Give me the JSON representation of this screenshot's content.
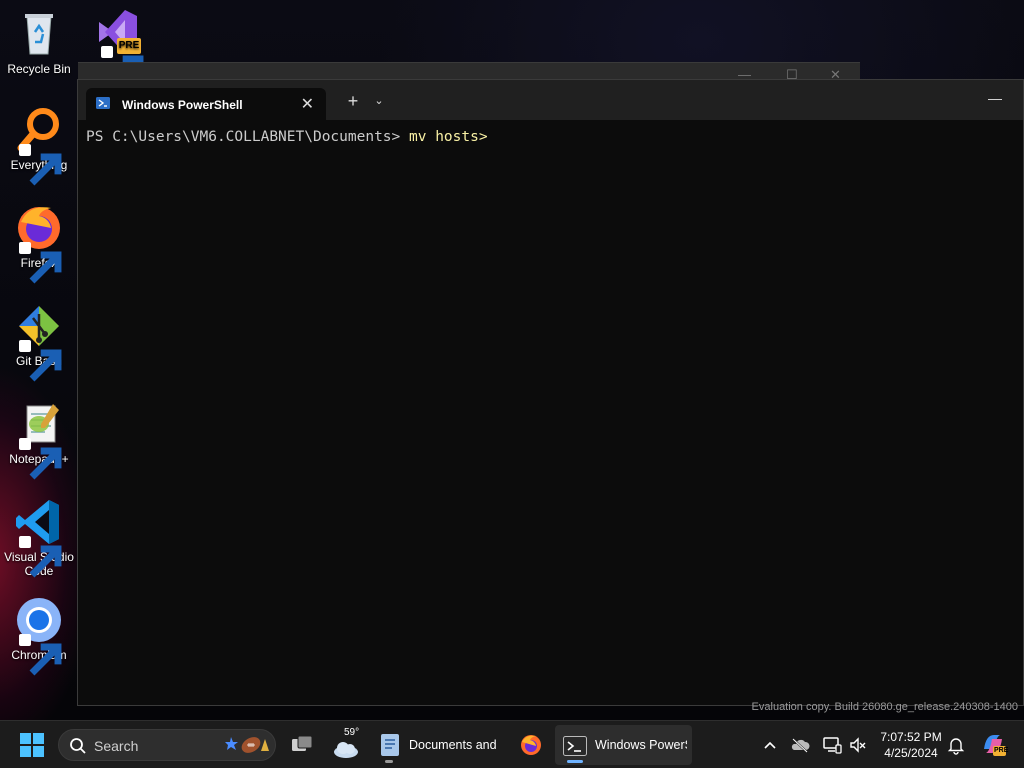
{
  "desktop": {
    "icons": [
      {
        "label": "Recycle Bin"
      },
      {
        "label": "Everything"
      },
      {
        "label": "Firefox"
      },
      {
        "label": "Git Bash"
      },
      {
        "label": "Notepad++"
      },
      {
        "label": "Visual Studio Code"
      },
      {
        "label": "Chromium"
      }
    ],
    "vs_preview_badge": "PRE"
  },
  "terminal": {
    "tab_title": "Windows PowerShell",
    "close_glyph": "✕",
    "new_tab_glyph": "+",
    "dropdown_glyph": "⌄",
    "minimize_glyph": "—",
    "prompt": "PS C:\\Users\\VM6.COLLABNET\\Documents> ",
    "command": "mv hosts>"
  },
  "watermark": "Evaluation copy. Build 26080.ge_release.240308-1400",
  "taskbar": {
    "search_placeholder": "Search",
    "weather_temp": "59°",
    "apps": [
      {
        "label": "Documents and '"
      },
      {
        "label": "Windows PowerS"
      }
    ],
    "clock_time": "7:07:52 PM",
    "clock_date": "4/25/2024",
    "copilot_badge": "PRE"
  },
  "colors": {
    "console_bg": "#0c0c0c",
    "console_fg": "#cccccc",
    "command_fg": "#f9f1a5",
    "taskbar_bg": "#1c1c1c",
    "accent": "#0078d4"
  }
}
